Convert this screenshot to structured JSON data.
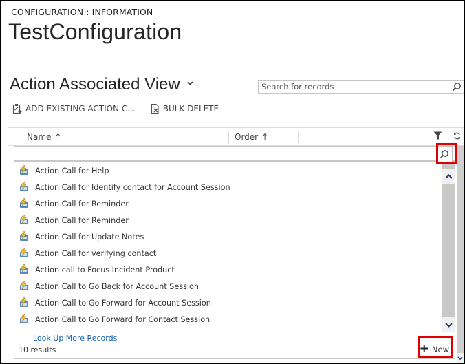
{
  "breadcrumb": "CONFIGURATION : INFORMATION",
  "record_title": "TestConfiguration",
  "view": {
    "title": "Action Associated View",
    "chevron_icon": "chevron-down-icon"
  },
  "search": {
    "placeholder": "Search for records",
    "icon": "search-icon"
  },
  "commands": {
    "add_existing": "ADD EXISTING ACTION C...",
    "bulk_delete": "BULK DELETE"
  },
  "grid": {
    "columns": [
      {
        "label": "Name",
        "sort": "ascending"
      },
      {
        "label": "Order",
        "sort": "ascending"
      }
    ],
    "sort_arrow": "↑"
  },
  "lookup": {
    "input_value": "",
    "items": [
      {
        "label": "Action Call for Help"
      },
      {
        "label": "Action Call for Identify contact for Account Session"
      },
      {
        "label": "Action Call for Reminder"
      },
      {
        "label": "Action Call for Reminder"
      },
      {
        "label": "Action Call for Update Notes"
      },
      {
        "label": "Action Call for verifying contact"
      },
      {
        "label": "Action call to Focus Incident Product"
      },
      {
        "label": "Action Call to Go Back for Account Session"
      },
      {
        "label": "Action Call to Go Forward for Account Session"
      },
      {
        "label": "Action Call to Go Forward for Contact Session"
      }
    ],
    "look_up_more": "Look Up More Records",
    "results_count": "10 results",
    "new_label": "New"
  },
  "colors": {
    "highlight": "#e00000",
    "link": "#1160b7",
    "scroll_arrow": "#1f3f6e"
  }
}
